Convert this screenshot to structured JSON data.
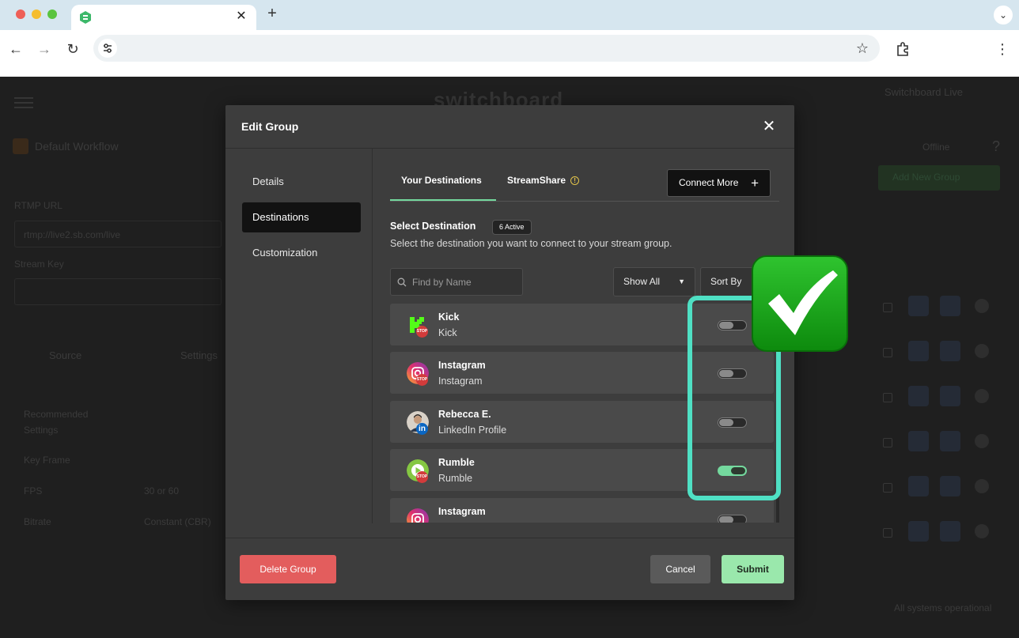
{
  "browser": {
    "new_tab_label": "+",
    "tab_close_label": "✕",
    "tab_menu_label": "⌄",
    "back_label": "←",
    "forward_label": "→",
    "reload_label": "↻",
    "bookmark_label": "☆",
    "menu_label": "⋮",
    "url": ""
  },
  "modal": {
    "title": "Edit Group",
    "close_label": "✕",
    "sidebar": [
      {
        "label": "Details"
      },
      {
        "label": "Destinations"
      },
      {
        "label": "Customization"
      }
    ],
    "tabs": [
      {
        "label": "Your Destinations"
      },
      {
        "label": "StreamShare"
      }
    ],
    "connect_more_label": "Connect More",
    "connect_more_icon": "+",
    "select_title": "Select Destination",
    "active_badge": "6 Active",
    "select_description": "Select the destination you want to connect to your stream group.",
    "search_placeholder": "Find by Name",
    "show_all_label": "Show All",
    "sort_by_label": "Sort By",
    "destinations": [
      {
        "name": "Kick",
        "subtitle": "Kick",
        "badge": "STOP",
        "icon": "kick-icon",
        "enabled": false
      },
      {
        "name": "Instagram",
        "subtitle": "Instagram",
        "badge": "STOP",
        "icon": "instagram-icon",
        "enabled": false
      },
      {
        "name": "Rebecca E.",
        "subtitle": "LinkedIn Profile",
        "badge": "in",
        "icon": "linkedin-icon",
        "enabled": false
      },
      {
        "name": "Rumble",
        "subtitle": "Rumble",
        "badge": "STOP",
        "icon": "rumble-icon",
        "enabled": true
      },
      {
        "name": "Instagram",
        "subtitle": "",
        "badge": "",
        "icon": "instagram-icon",
        "enabled": false
      }
    ],
    "delete_label": "Delete Group",
    "cancel_label": "Cancel",
    "submit_label": "Submit"
  },
  "colors": {
    "accent_green": "#74d99e",
    "delete_red": "#e35d5d",
    "highlight": "#4fe0c4",
    "checkmark_green": "#1fa21f"
  }
}
